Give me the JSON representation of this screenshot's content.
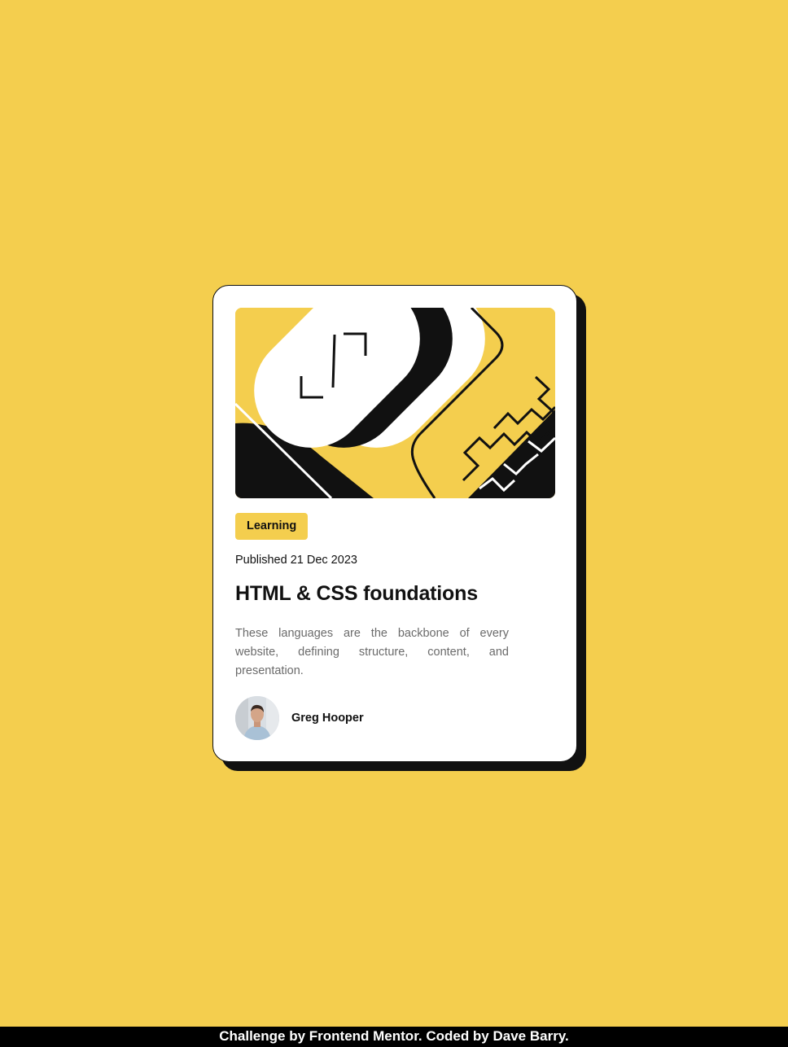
{
  "card": {
    "tag": "Learning",
    "published": "Published 21 Dec 2023",
    "title": "HTML & CSS foundations",
    "description": "These languages are the backbone of every website, defining structure, content, and presentation.",
    "author": {
      "name": "Greg Hooper"
    }
  },
  "footer": {
    "text": "Challenge by Frontend Mentor. Coded by Dave Barry."
  },
  "colors": {
    "background": "#F4CE4E",
    "card": "#FFFFFF",
    "ink": "#111111",
    "muted_text": "#6B6B6B",
    "footer_bg": "#000000"
  },
  "icons": {
    "hero": "abstract-illustration",
    "avatar": "author-photo"
  }
}
